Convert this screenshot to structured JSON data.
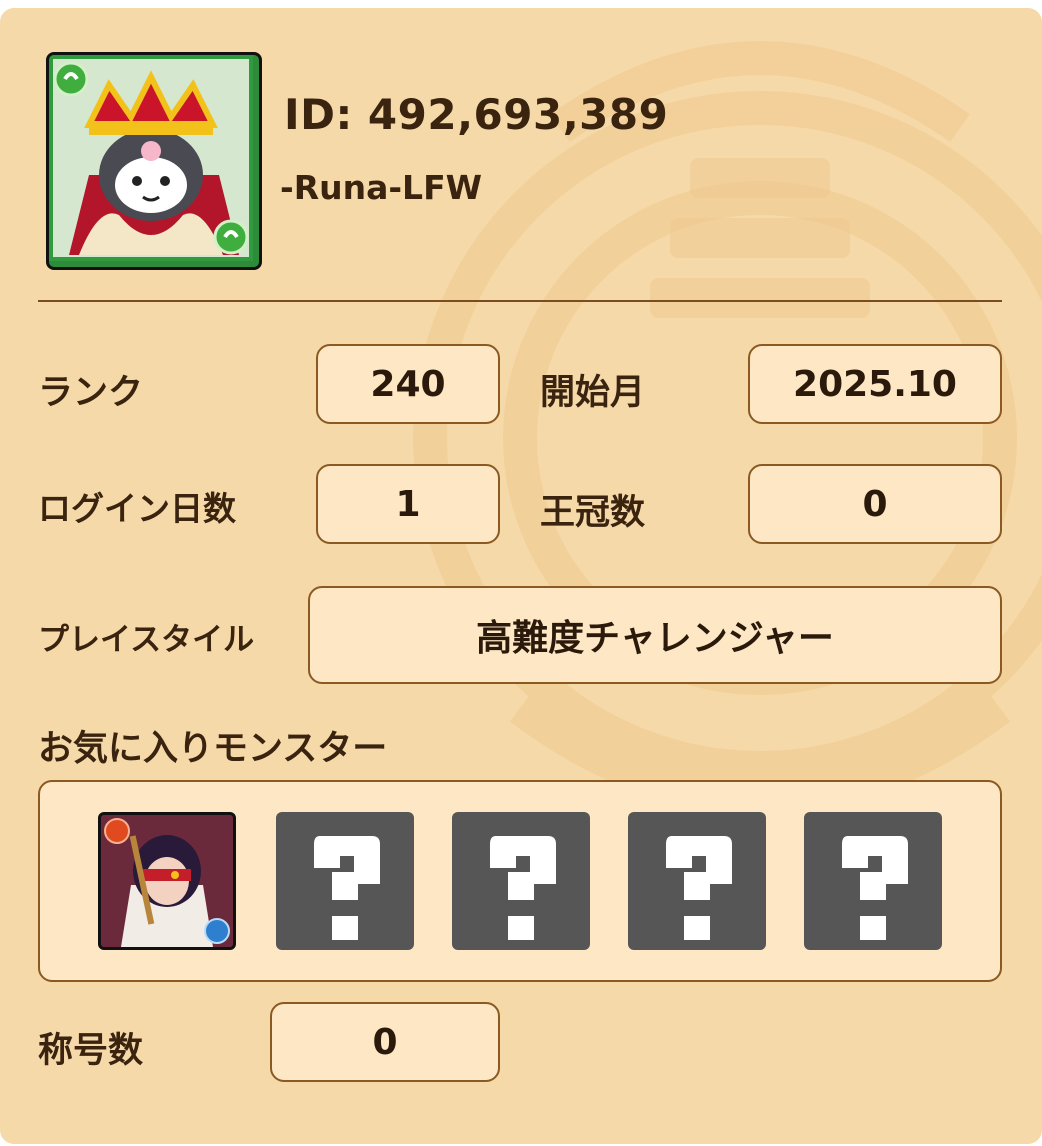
{
  "profile": {
    "id_text": "ID: 492,693,389",
    "name": "-Runa-LFW",
    "avatar_icon": "kuromi-king-monster-icon"
  },
  "stats": {
    "rank_label": "ランク",
    "rank_value": "240",
    "start_label": "開始月",
    "start_value": "2025.10",
    "login_label": "ログイン日数",
    "login_value": "1",
    "crown_label": "王冠数",
    "crown_value": "0",
    "playstyle_label": "プレイスタイル",
    "playstyle_value": "高難度チャレンジャー"
  },
  "favorites": {
    "title": "お気に入りモンスター",
    "slots": [
      {
        "type": "monster",
        "icon": "masked-swordswoman-monster-icon"
      },
      {
        "type": "unknown",
        "icon": "question-mark-icon"
      },
      {
        "type": "unknown",
        "icon": "question-mark-icon"
      },
      {
        "type": "unknown",
        "icon": "question-mark-icon"
      },
      {
        "type": "unknown",
        "icon": "question-mark-icon"
      }
    ]
  },
  "titles": {
    "label": "称号数",
    "value": "0"
  },
  "colors": {
    "background": "#f6d9a9",
    "box_fill": "#fde7c4",
    "box_border": "#8b5a22",
    "text": "#3a2410",
    "unknown_slot": "#565656"
  }
}
